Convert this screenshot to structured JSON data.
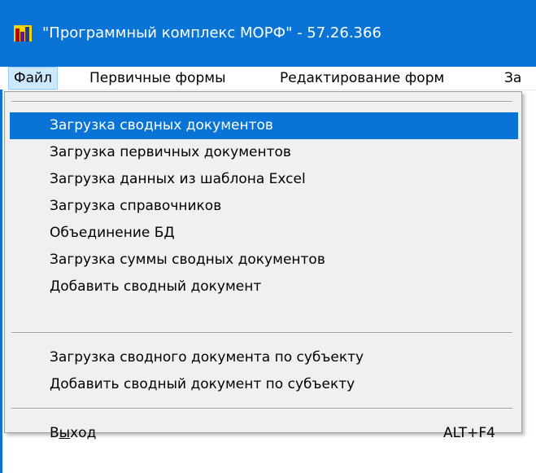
{
  "window": {
    "title": "\"Программный комплекс МОРФ\" - 57.26.366",
    "colors": {
      "titlebar": "#0a74d6",
      "highlight": "#0a74d6",
      "menu_bg": "#f0f0f0"
    }
  },
  "icons": {
    "app": "bar-chart-app-icon"
  },
  "menubar": {
    "items": [
      {
        "label": "Файл",
        "active": true
      },
      {
        "label": "Первичные формы"
      },
      {
        "label": "Редактирование форм"
      },
      {
        "label": "За"
      }
    ]
  },
  "file_menu": {
    "group1": [
      {
        "label": "Загрузка сводных документов",
        "highlighted": true
      },
      {
        "label": "Загрузка первичных документов"
      },
      {
        "label": "Загрузка данных из шаблона Excel"
      },
      {
        "label": "Загрузка справочников"
      },
      {
        "label": "Объединение БД"
      },
      {
        "label": "Загрузка суммы сводных документов"
      },
      {
        "label": "Добавить сводный документ"
      }
    ],
    "group2": [
      {
        "label": "Загрузка сводного документа по субъекту"
      },
      {
        "label": "Добавить сводный документ по субъекту"
      }
    ],
    "exit": {
      "label_pre": "В",
      "label_underlined": "ы",
      "label_post": "ход",
      "shortcut": "ALT+F4"
    }
  }
}
